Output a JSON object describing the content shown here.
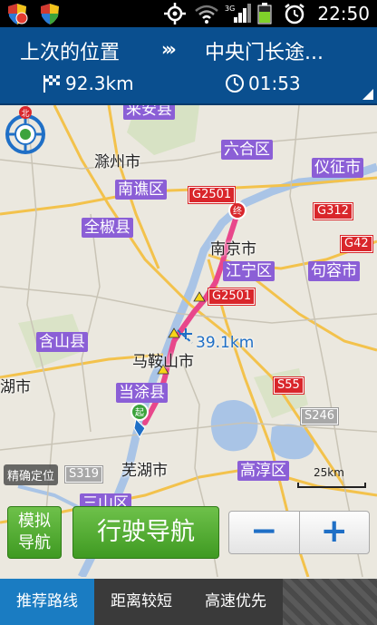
{
  "status_bar": {
    "time": "22:50",
    "icons": [
      "shield-refresh-icon",
      "shield-icon",
      "gps-icon",
      "wifi-icon",
      "signal-3g-icon",
      "battery-icon",
      "alarm-icon"
    ]
  },
  "header": {
    "origin": "上次的位置",
    "arrows": "›››",
    "destination": "中央门长途...",
    "distance": "92.3km",
    "duration": "01:53"
  },
  "map": {
    "places": [
      {
        "key": "chuzhou",
        "text": "滁州市"
      },
      {
        "key": "nanqiao",
        "text": "南谯区"
      },
      {
        "key": "quanjiao",
        "text": "全椒县"
      },
      {
        "key": "nanjing",
        "text": "南京市"
      },
      {
        "key": "maanshan",
        "text": "马鞍山市"
      },
      {
        "key": "wuhu",
        "text": "芜湖市"
      },
      {
        "key": "hushi",
        "text": "湖市"
      }
    ],
    "districts": [
      {
        "key": "laian",
        "text": "来安县"
      },
      {
        "key": "luhe",
        "text": "六合区"
      },
      {
        "key": "yizheng",
        "text": "仪征市"
      },
      {
        "key": "jiangning",
        "text": "江宁区"
      },
      {
        "key": "jurong",
        "text": "句容市"
      },
      {
        "key": "hanshan",
        "text": "含山县"
      },
      {
        "key": "dangtu",
        "text": "当涂县"
      },
      {
        "key": "gaochun",
        "text": "高淳区"
      },
      {
        "key": "sanshan",
        "text": "三山区"
      }
    ],
    "highways": [
      {
        "key": "g2501a",
        "text": "G2501"
      },
      {
        "key": "g312",
        "text": "G312"
      },
      {
        "key": "g42",
        "text": "G42"
      },
      {
        "key": "g2501b",
        "text": "G2501"
      },
      {
        "key": "s55",
        "text": "S55"
      }
    ],
    "gray_roads": [
      {
        "key": "s246",
        "text": "S246"
      },
      {
        "key": "s319",
        "text": "S319"
      }
    ],
    "route_distance": "39.1km",
    "scale": "25km",
    "start_marker": "起",
    "end_marker": "终",
    "compass_label": "北",
    "locate_label": "精确定位",
    "colors": {
      "route": "#e8478b",
      "water": "#a9c4e6",
      "district_bg": "#8b5fd6",
      "highway": "#d9262b"
    }
  },
  "controls": {
    "simulate_line1": "模拟",
    "simulate_line2": "导航",
    "navigate": "行驶导航",
    "zoom_out": "−",
    "zoom_in": "+"
  },
  "tabs": [
    {
      "label": "推荐路线",
      "active": true
    },
    {
      "label": "距离较短",
      "active": false
    },
    {
      "label": "高速优先",
      "active": false
    }
  ],
  "colors": {
    "header_bg": "#0a4f8f",
    "button_green": "#4fa82c",
    "tab_active": "#1a7cc2"
  }
}
